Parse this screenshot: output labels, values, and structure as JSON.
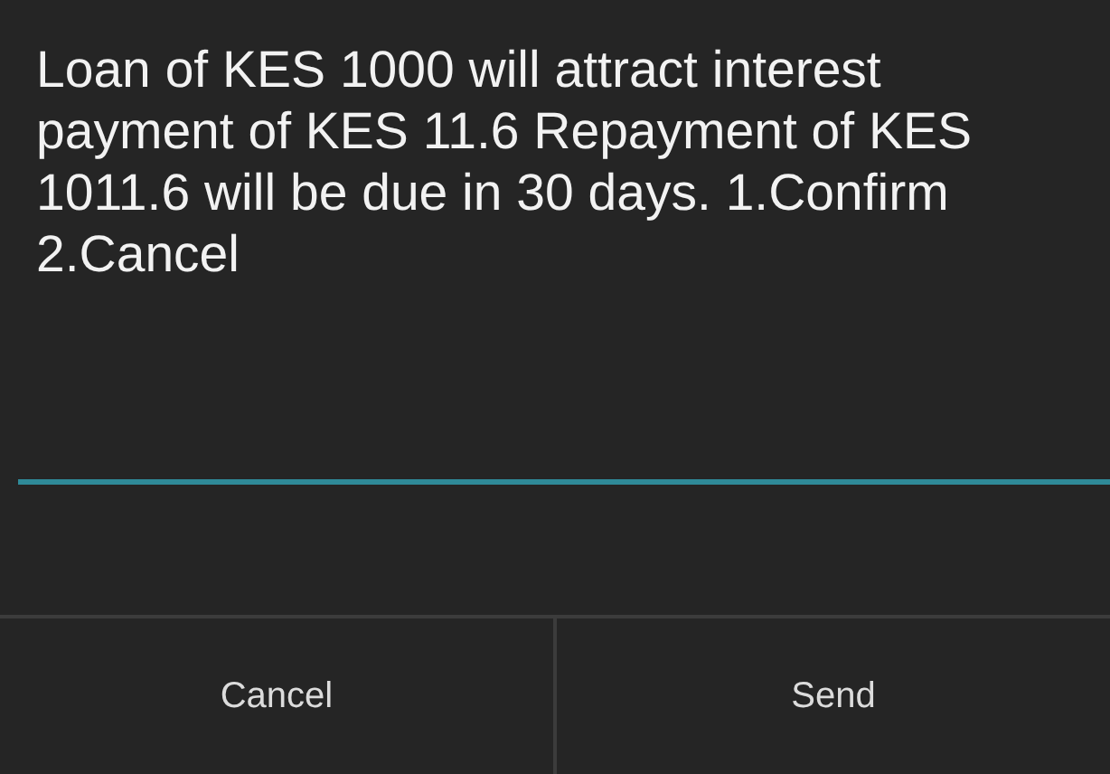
{
  "dialog": {
    "message": "Loan of KES 1000 will attract interest payment of KES 11.6 Repayment of KES 1011.6 will be due in 30 days. 1.Confirm 2.Cancel"
  },
  "buttons": [
    {
      "label": "Cancel"
    },
    {
      "label": "Send"
    }
  ]
}
